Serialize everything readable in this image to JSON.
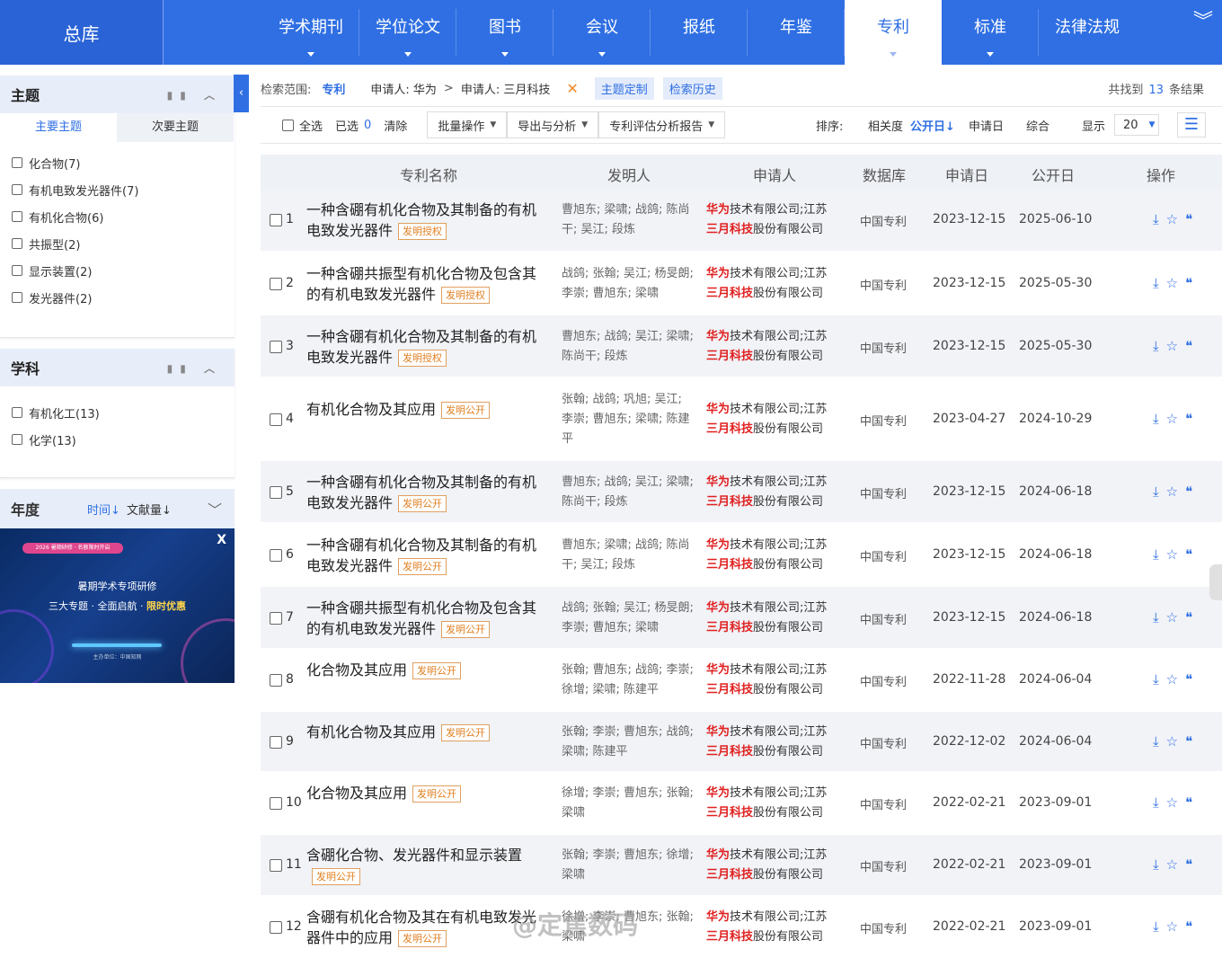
{
  "topnav": {
    "home_label": "总库",
    "tabs": [
      {
        "label": "学术期刊"
      },
      {
        "label": "学位论文"
      },
      {
        "label": "图书"
      },
      {
        "label": "会议"
      },
      {
        "label": "报纸"
      },
      {
        "label": "年鉴"
      },
      {
        "label": "专利"
      },
      {
        "label": "标准"
      },
      {
        "label": "法律法规"
      }
    ],
    "active_tab": "专利"
  },
  "sidebar": {
    "topic": {
      "title": "主题",
      "tabs": [
        "主要主题",
        "次要主题"
      ],
      "items": [
        "化合物(7)",
        "有机电致发光器件(7)",
        "有机化合物(6)",
        "共振型(2)",
        "显示装置(2)",
        "发光器件(2)"
      ]
    },
    "subject": {
      "title": "学科",
      "items": [
        "有机化工(13)",
        "化学(13)"
      ]
    },
    "year": {
      "title": "年度",
      "sort_time": "时间",
      "sort_count": "文献量"
    },
    "banner": {
      "pill_text": "2026 暑期研修 · 名额限时开启",
      "title": "暑期学术专项研修",
      "subtitle_a": "三大专题 · 全面启航 · ",
      "subtitle_b": "限时优惠",
      "footer": "主办单位：中国知网",
      "close": "X"
    }
  },
  "scope": {
    "label": "检索范围:",
    "value": "专利",
    "crumb1": "申请人: 华为",
    "crumb2": "申请人: 三月科技",
    "btn_custom": "主题定制",
    "btn_history": "检索历史",
    "count_prefix": "共找到",
    "count": "13",
    "count_suffix": "条结果"
  },
  "toolbar": {
    "select_all": "全选",
    "selected_label": "已选",
    "selected_count": "0",
    "clear": "清除",
    "batch": "批量操作",
    "export": "导出与分析",
    "report": "专利评估分析报告",
    "sort_label": "排序:",
    "sort_relevance": "相关度",
    "sort_pubdate": "公开日",
    "sort_appdate": "申请日",
    "sort_overall": "综合",
    "display_label": "显示",
    "page_size": "20"
  },
  "table": {
    "headers": [
      "专利名称",
      "发明人",
      "申请人",
      "数据库",
      "申请日",
      "公开日",
      "操作"
    ],
    "rows": [
      {
        "num": "1",
        "title": "一种含硼有机化合物及其制备的有机电致发光器件",
        "badge": "发明授权",
        "inventors": "曹旭东; 梁啸; 战鸽; 陈尚干; 吴江; 段炼",
        "app_a": "华为",
        "app_b": "技术有限公司;江苏",
        "app_c": "三月科技",
        "app_d": "股份有限公司",
        "db": "中国专利",
        "app_date": "2023-12-15",
        "pub_date": "2025-06-10"
      },
      {
        "num": "2",
        "title": "一种含硼共振型有机化合物及包含其的有机电致发光器件",
        "badge": "发明授权",
        "inventors": "战鸽; 张翰; 吴江; 杨旻朗; 李崇; 曹旭东; 梁啸",
        "app_a": "华为",
        "app_b": "技术有限公司;江苏",
        "app_c": "三月科技",
        "app_d": "股份有限公司",
        "db": "中国专利",
        "app_date": "2023-12-15",
        "pub_date": "2025-05-30"
      },
      {
        "num": "3",
        "title": "一种含硼有机化合物及其制备的有机电致发光器件",
        "badge": "发明授权",
        "inventors": "曹旭东; 战鸽; 吴江; 梁啸; 陈尚干; 段炼",
        "app_a": "华为",
        "app_b": "技术有限公司;江苏",
        "app_c": "三月科技",
        "app_d": "股份有限公司",
        "db": "中国专利",
        "app_date": "2023-12-15",
        "pub_date": "2025-05-30"
      },
      {
        "num": "4",
        "title": "有机化合物及其应用",
        "badge": "发明公开",
        "inventors": "张翰; 战鸽; 巩旭; 吴江; 李崇; 曹旭东; 梁啸; 陈建平",
        "app_a": "华为",
        "app_b": "技术有限公司;江苏",
        "app_c": "三月科技",
        "app_d": "股份有限公司",
        "db": "中国专利",
        "app_date": "2023-04-27",
        "pub_date": "2024-10-29"
      },
      {
        "num": "5",
        "title": "一种含硼有机化合物及其制备的有机电致发光器件",
        "badge": "发明公开",
        "inventors": "曹旭东; 战鸽; 吴江; 梁啸; 陈尚干; 段炼",
        "app_a": "华为",
        "app_b": "技术有限公司;江苏",
        "app_c": "三月科技",
        "app_d": "股份有限公司",
        "db": "中国专利",
        "app_date": "2023-12-15",
        "pub_date": "2024-06-18"
      },
      {
        "num": "6",
        "title": "一种含硼有机化合物及其制备的有机电致发光器件",
        "badge": "发明公开",
        "inventors": "曹旭东; 梁啸; 战鸽; 陈尚干; 吴江; 段炼",
        "app_a": "华为",
        "app_b": "技术有限公司;江苏",
        "app_c": "三月科技",
        "app_d": "股份有限公司",
        "db": "中国专利",
        "app_date": "2023-12-15",
        "pub_date": "2024-06-18"
      },
      {
        "num": "7",
        "title": "一种含硼共振型有机化合物及包含其的有机电致发光器件",
        "badge": "发明公开",
        "inventors": "战鸽; 张翰; 吴江; 杨旻朗; 李崇; 曹旭东; 梁啸",
        "app_a": "华为",
        "app_b": "技术有限公司;江苏",
        "app_c": "三月科技",
        "app_d": "股份有限公司",
        "db": "中国专利",
        "app_date": "2023-12-15",
        "pub_date": "2024-06-18"
      },
      {
        "num": "8",
        "title": "化合物及其应用",
        "badge": "发明公开",
        "inventors": "张翰; 曹旭东; 战鸽; 李崇; 徐增; 梁啸; 陈建平",
        "app_a": "华为",
        "app_b": "技术有限公司;江苏",
        "app_c": "三月科技",
        "app_d": "股份有限公司",
        "db": "中国专利",
        "app_date": "2022-11-28",
        "pub_date": "2024-06-04"
      },
      {
        "num": "9",
        "title": "有机化合物及其应用",
        "badge": "发明公开",
        "inventors": "张翰; 李崇; 曹旭东; 战鸽; 梁啸; 陈建平",
        "app_a": "华为",
        "app_b": "技术有限公司;江苏",
        "app_c": "三月科技",
        "app_d": "股份有限公司",
        "db": "中国专利",
        "app_date": "2022-12-02",
        "pub_date": "2024-06-04"
      },
      {
        "num": "10",
        "title": "化合物及其应用",
        "badge": "发明公开",
        "inventors": "徐增; 李崇; 曹旭东; 张翰; 梁啸",
        "app_a": "华为",
        "app_b": "技术有限公司;江苏",
        "app_c": "三月科技",
        "app_d": "股份有限公司",
        "db": "中国专利",
        "app_date": "2022-02-21",
        "pub_date": "2023-09-01"
      },
      {
        "num": "11",
        "title": "含硼化合物、发光器件和显示装置",
        "badge": "发明公开",
        "inventors": "张翰; 李崇; 曹旭东; 徐增; 梁啸",
        "app_a": "华为",
        "app_b": "技术有限公司;江苏",
        "app_c": "三月科技",
        "app_d": "股份有限公司",
        "db": "中国专利",
        "app_date": "2022-02-21",
        "pub_date": "2023-09-01"
      },
      {
        "num": "12",
        "title": "含硼有机化合物及其在有机电致发光器件中的应用",
        "badge": "发明公开",
        "inventors": "徐增; 李崇; 曹旭东; 张翰; 梁啸",
        "app_a": "华为",
        "app_b": "技术有限公司;江苏",
        "app_c": "三月科技",
        "app_d": "股份有限公司",
        "db": "中国专利",
        "app_date": "2022-02-21",
        "pub_date": "2023-09-01"
      }
    ]
  },
  "watermark": "@定焦数码",
  "colors": {
    "accent": "#2f6fe3",
    "highlight": "#e02020",
    "badge": "#e07f20"
  }
}
